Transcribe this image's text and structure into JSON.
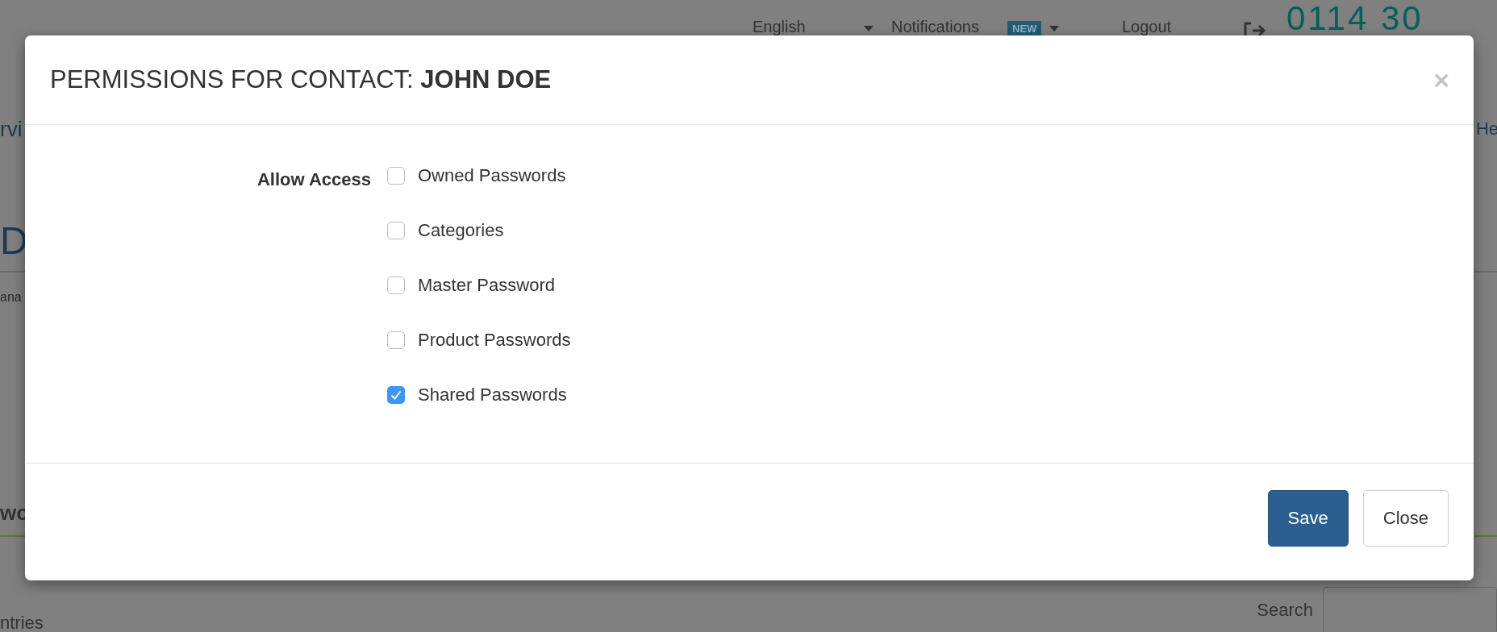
{
  "background_page": {
    "top_nav": {
      "language": "English",
      "notifications": "Notifications",
      "notifications_badge": "NEW",
      "logout": "Logout",
      "phone": "0114 30"
    },
    "nav_left_fragment": "rvi",
    "nav_right_fragment": "He",
    "heading_fragment": "D",
    "subtitle_fragment": "ana",
    "tab_fragment": "wo",
    "entries_fragment": "ntries",
    "search_label": "Search"
  },
  "dialog": {
    "title": "PERMISSIONS FOR CONTACT: **JOHN DOE**",
    "close_symbol": "×",
    "field_label": "Allow Access",
    "options": [
      {
        "label": "Owned Passwords",
        "checked": false
      },
      {
        "label": "Categories",
        "checked": false
      },
      {
        "label": "Master Password",
        "checked": false
      },
      {
        "label": "Product Passwords",
        "checked": false
      },
      {
        "label": "Shared Passwords",
        "checked": true
      }
    ],
    "buttons": [
      {
        "label": "Save",
        "kind": "primary"
      },
      {
        "label": "Close",
        "kind": "default"
      }
    ]
  }
}
